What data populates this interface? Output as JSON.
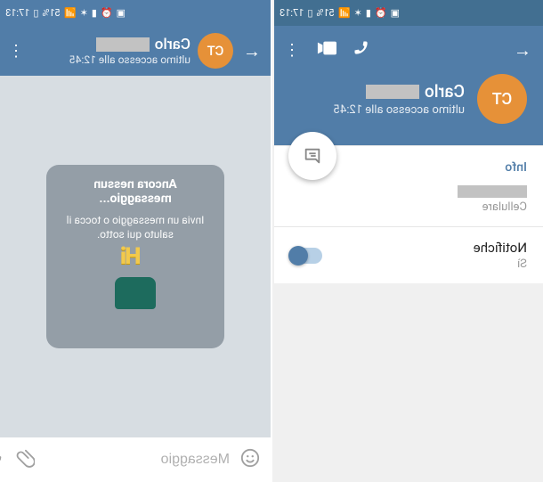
{
  "status_bar": {
    "time": "17:13",
    "battery_pct": "51%"
  },
  "left_screen": {
    "contact_name": "Carlo",
    "avatar_initials": "CT",
    "last_seen": "ultimo accesso alle 12:45",
    "info_section_title": "Info",
    "phone_label": "Cellulare",
    "notifications_title": "Notifiche",
    "notifications_value": "Sì",
    "notifications_on": true
  },
  "right_screen": {
    "contact_name": "Carlo",
    "avatar_initials": "CT",
    "last_seen": "ultimo accesso alle 12:45",
    "empty_title": "Ancora nessun messaggio...",
    "empty_body": "Invia un messaggio o tocca il saluto qui sotto.",
    "compose_placeholder": "Messaggio"
  },
  "colors": {
    "accent": "#517da8",
    "avatar": "#e69138"
  }
}
